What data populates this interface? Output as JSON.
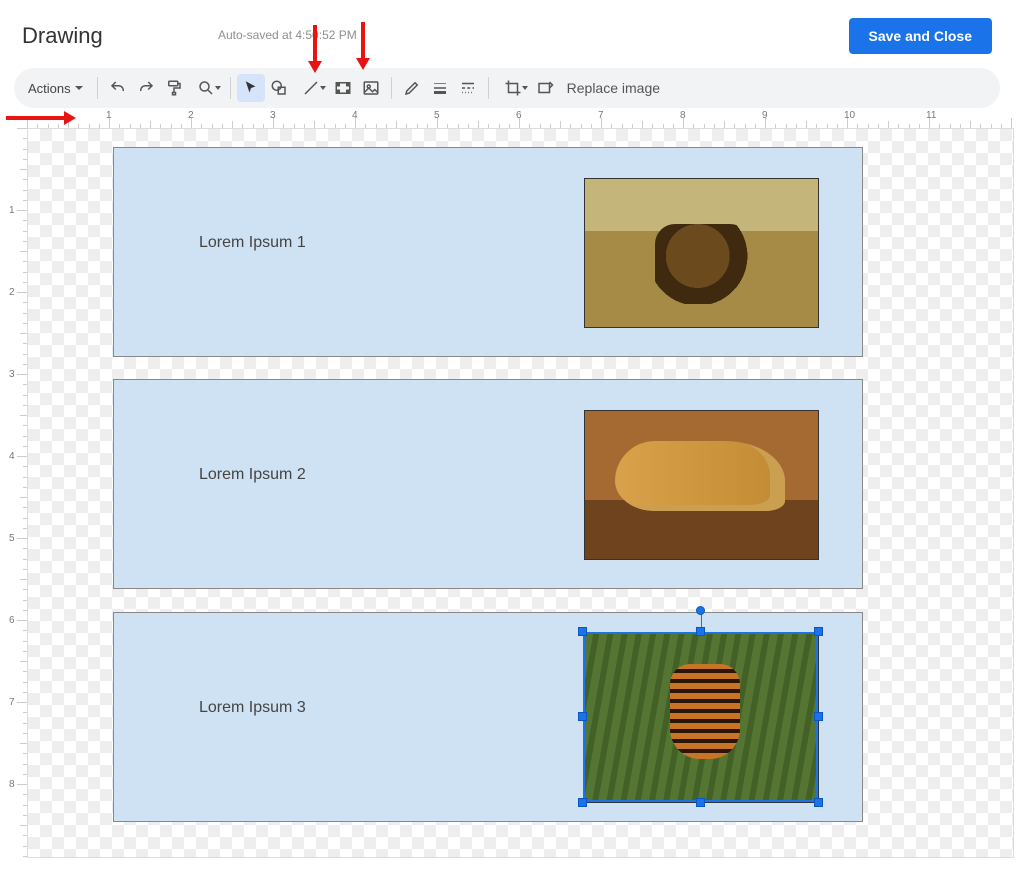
{
  "header": {
    "title": "Drawing",
    "autosave": "Auto-saved at 4:50:52 PM",
    "save_btn": "Save and Close"
  },
  "toolbar": {
    "actions_label": "Actions",
    "replace_label": "Replace image",
    "icons": {
      "undo": "undo-icon",
      "redo": "redo-icon",
      "paint": "paint-format-icon",
      "zoom": "zoom-icon",
      "select": "select-icon",
      "shape": "shape-icon",
      "line": "line-icon",
      "textbox": "text-box-icon",
      "image": "image-icon",
      "pencil": "pencil-icon",
      "border_weight": "border-weight-icon",
      "border_dash": "border-dash-icon",
      "crop": "crop-icon",
      "reset_image": "reset-image-icon"
    }
  },
  "ruler": {
    "h_labels": [
      "1",
      "2",
      "3",
      "4",
      "5",
      "6",
      "7",
      "8",
      "9",
      "10",
      "11"
    ],
    "v_labels": [
      "1",
      "2",
      "3",
      "4",
      "5",
      "6",
      "7",
      "8"
    ]
  },
  "canvas": {
    "cards": [
      {
        "label": "Lorem Ipsum 1",
        "image_name": "lion-image"
      },
      {
        "label": "Lorem Ipsum 2",
        "image_name": "cheetah-image"
      },
      {
        "label": "Lorem Ipsum 3",
        "image_name": "tiger-image"
      }
    ],
    "selected_index": 2
  }
}
